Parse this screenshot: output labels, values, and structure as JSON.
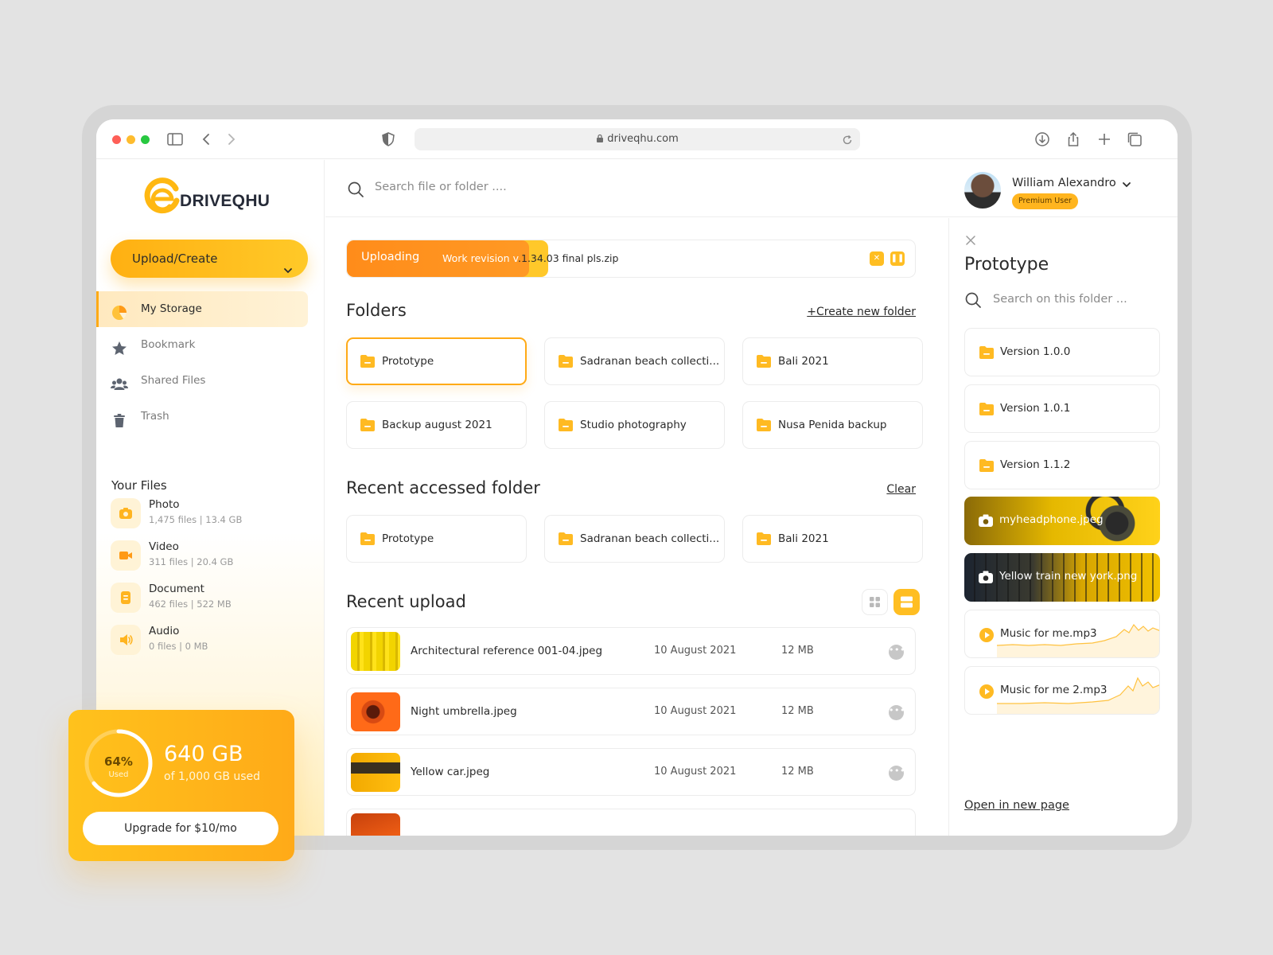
{
  "browser": {
    "url": "driveqhu.com"
  },
  "brand": {
    "name": "DRIVEQHU",
    "accent": "#FFAA16",
    "accent_light": "#FFC928"
  },
  "sidebar": {
    "upload_label": "Upload/Create",
    "nav": [
      {
        "label": "My Storage",
        "icon": "pie-chart-icon",
        "active": true
      },
      {
        "label": "Bookmark",
        "icon": "star-icon",
        "active": false
      },
      {
        "label": "Shared Files",
        "icon": "users-icon",
        "active": false
      },
      {
        "label": "Trash",
        "icon": "trash-icon",
        "active": false
      }
    ],
    "your_files_title": "Your Files",
    "file_types": [
      {
        "name": "Photo",
        "meta": "1,475 files  |  13.4 GB",
        "icon": "camera-icon"
      },
      {
        "name": "Video",
        "meta": "311 files  |  20.4 GB",
        "icon": "video-icon"
      },
      {
        "name": "Document",
        "meta": "462 files  |  522 MB",
        "icon": "document-icon"
      },
      {
        "name": "Audio",
        "meta": "0 files  |  0 MB",
        "icon": "speaker-icon"
      }
    ]
  },
  "search": {
    "placeholder": "Search file or folder ...."
  },
  "user": {
    "name": "William Alexandro",
    "badge": "Premium User"
  },
  "upload_progress": {
    "label": "Uploading",
    "file_prefix": "Work revision v",
    "file_rest": ".1.34.03 final pls.zip",
    "progress": 0.32
  },
  "folders": {
    "title": "Folders",
    "create_link": "+Create new folder",
    "items": [
      "Prototype",
      "Sadranan beach collecti...",
      "Bali 2021",
      "Backup august 2021",
      "Studio photography",
      "Nusa Penida backup"
    ]
  },
  "recent_folders": {
    "title": "Recent accessed folder",
    "clear_link": "Clear",
    "items": [
      "Prototype",
      "Sadranan beach collecti...",
      "Bali 2021"
    ]
  },
  "recent_upload": {
    "title": "Recent upload",
    "rows": [
      {
        "name": "Architectural reference 001-04.jpeg",
        "date": "10 August 2021",
        "size": "12 MB"
      },
      {
        "name": "Night umbrella.jpeg",
        "date": "10 August 2021",
        "size": "12 MB"
      },
      {
        "name": "Yellow car.jpeg",
        "date": "10 August 2021",
        "size": "12 MB"
      }
    ]
  },
  "panel": {
    "title": "Prototype",
    "search_placeholder": "Search on this folder ...",
    "items": [
      {
        "name": "Version 1.0.0",
        "type": "folder"
      },
      {
        "name": "Version 1.0.1",
        "type": "folder"
      },
      {
        "name": "Version 1.1.2",
        "type": "folder"
      },
      {
        "name": "myheadphone.jpeg",
        "type": "photo"
      },
      {
        "name": "Yellow train new york.png",
        "type": "photo"
      },
      {
        "name": "Music for me.mp3",
        "type": "audio"
      },
      {
        "name": "Music for me 2.mp3",
        "type": "audio"
      }
    ],
    "open_link": "Open in new page"
  },
  "storage": {
    "percent_label": "64%",
    "used_label": "Used",
    "used_fraction": 0.64,
    "size": "640 GB",
    "of_text": "of 1,000 GB used",
    "upgrade_label": "Upgrade for $10/mo"
  }
}
